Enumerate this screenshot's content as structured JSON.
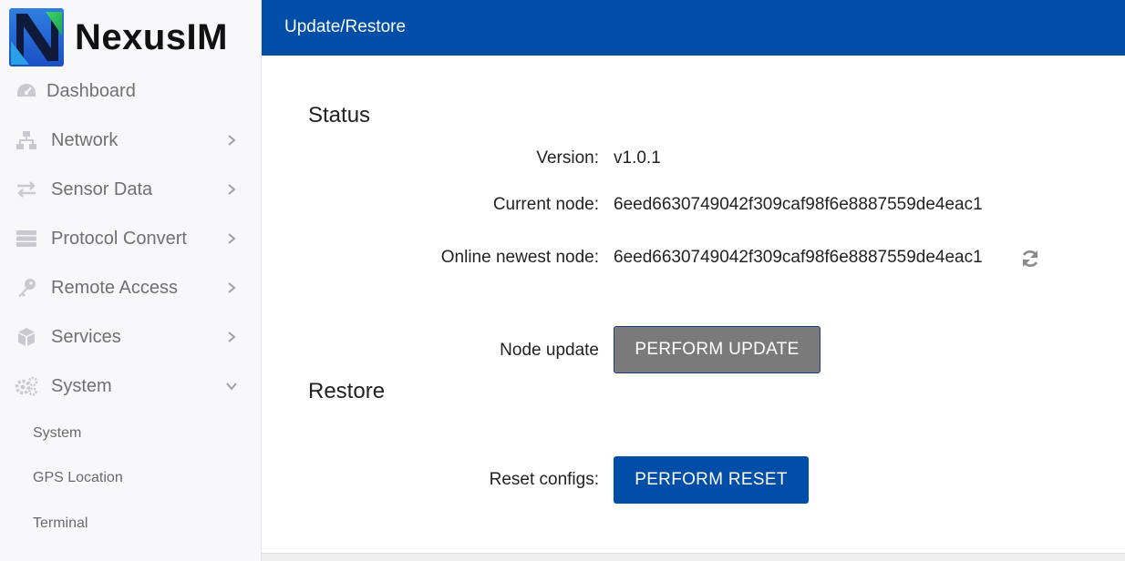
{
  "app": {
    "brand": "NexusIM"
  },
  "sidebar": {
    "items": [
      {
        "label": "Dashboard",
        "icon": "dashboard-icon"
      },
      {
        "label": "Network",
        "icon": "network-icon"
      },
      {
        "label": "Sensor Data",
        "icon": "exchange-arrows-icon"
      },
      {
        "label": "Protocol Convert",
        "icon": "server-icon"
      },
      {
        "label": "Remote Access",
        "icon": "key-icon"
      },
      {
        "label": "Services",
        "icon": "cube-icon"
      },
      {
        "label": "System",
        "icon": "gears-icon"
      }
    ],
    "subitems": [
      {
        "label": "System"
      },
      {
        "label": "GPS Location"
      },
      {
        "label": "Terminal"
      }
    ]
  },
  "header": {
    "title": "Update/Restore"
  },
  "status": {
    "title": "Status",
    "version_label": "Version:",
    "version_value": "v1.0.1",
    "current_node_label": "Current node:",
    "current_node_value": "6eed6630749042f309caf98f6e8887559de4eac1",
    "online_node_label": "Online newest node:",
    "online_node_value": "6eed6630749042f309caf98f6e8887559de4eac1",
    "node_update_label": "Node update",
    "update_button": "PERFORM UPDATE"
  },
  "restore": {
    "title": "Restore",
    "reset_label": "Reset configs:",
    "reset_button": "PERFORM RESET"
  },
  "colors": {
    "primary": "#004ea8",
    "disabled_button": "#7a7a7a",
    "sidebar_bg": "#f8f8fb",
    "muted_text": "#707070"
  }
}
